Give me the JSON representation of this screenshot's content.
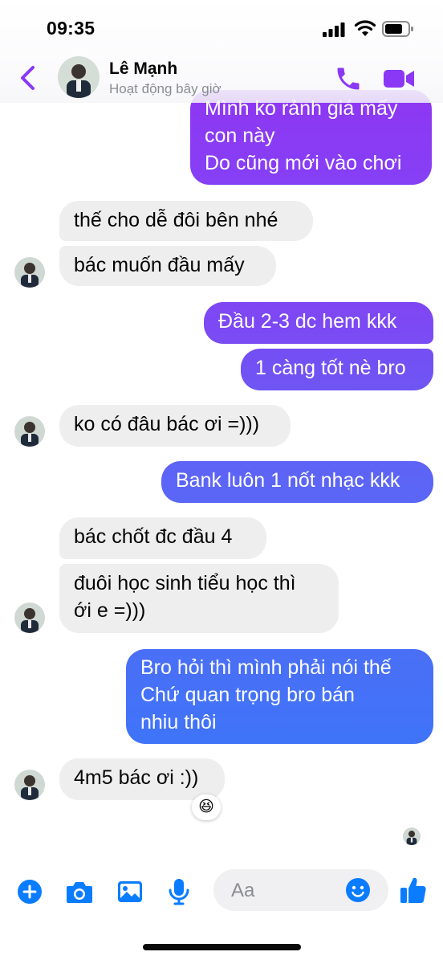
{
  "status_bar": {
    "time": "09:35"
  },
  "header": {
    "name": "Lê Mạnh",
    "status": "Hoạt động bây giờ"
  },
  "messages": [
    {
      "side": "out",
      "text": "Mình ko rảnh giá mấy\ncon này\nDo cũng mới vào chơi"
    },
    {
      "side": "in",
      "text": "thế cho dễ đôi bên nhé"
    },
    {
      "side": "in",
      "text": "bác muốn đầu mấy"
    },
    {
      "side": "out",
      "text": "Đầu 2-3 dc hem kkk"
    },
    {
      "side": "out",
      "text": "1 càng tốt nè bro"
    },
    {
      "side": "in",
      "text": "ko có đâu bác ơi =)))"
    },
    {
      "side": "out",
      "text": "Bank luôn 1 nốt nhạc kkk"
    },
    {
      "side": "in",
      "text": "bác chốt đc đầu 4"
    },
    {
      "side": "in",
      "text": "đuôi học sinh tiểu học thì\nới e =)))"
    },
    {
      "side": "out",
      "text": "Bro hỏi thì mình phải nói thế\nChứ quan trọng bro bán\nnhiu thôi"
    },
    {
      "side": "in",
      "text": "4m5 bác ơi :))",
      "reaction": "😆"
    }
  ],
  "composer": {
    "placeholder": "Aa"
  },
  "colors": {
    "accent_purple": "#8a38f5",
    "accent_blue": "#0a7cff",
    "bubble_incoming": "#eeeeee"
  },
  "icons": [
    "back-icon",
    "phone-icon",
    "video-camera-icon",
    "plus-icon",
    "camera-icon",
    "gallery-icon",
    "microphone-icon",
    "emoji-icon",
    "thumbs-up-icon"
  ]
}
